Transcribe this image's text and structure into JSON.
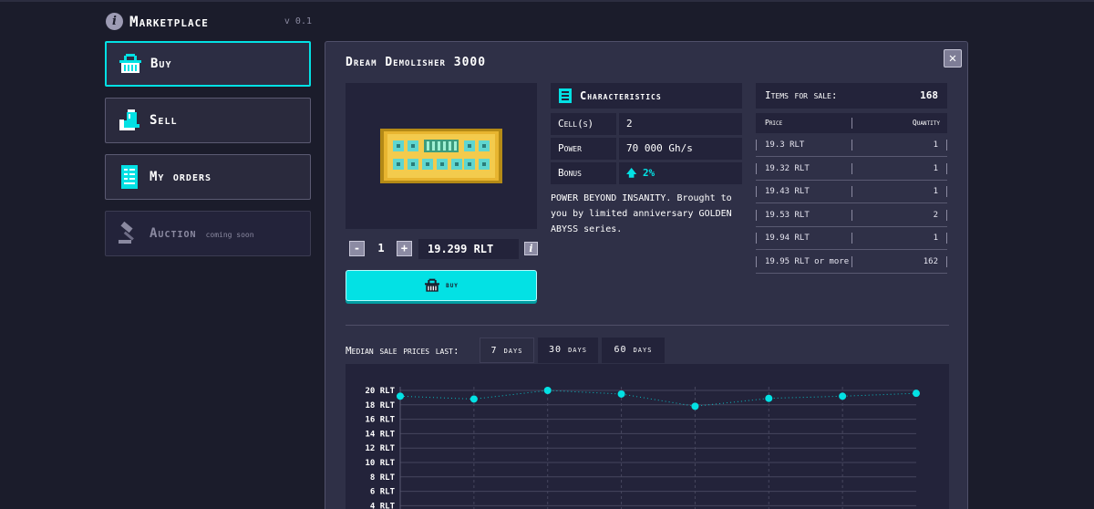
{
  "header": {
    "title": "Marketplace",
    "version": "v 0.1"
  },
  "sidebar": {
    "items": [
      {
        "label": "Buy",
        "icon": "basket-icon"
      },
      {
        "label": "Sell",
        "icon": "hand-bag-icon"
      },
      {
        "label": "My orders",
        "icon": "receipt-icon"
      },
      {
        "label": "Auction",
        "icon": "gavel-icon",
        "note": "coming soon"
      }
    ]
  },
  "product": {
    "title": "Dream Demolisher 3000",
    "quantity": "1",
    "price": "19.299 RLT",
    "buy_label": "buy"
  },
  "characteristics": {
    "title": "Characteristics",
    "rows": [
      {
        "key": "Cell(s)",
        "value": "2"
      },
      {
        "key": "Power",
        "value": "70 000 Gh/s"
      },
      {
        "key": "Bonus",
        "value": "2%"
      }
    ],
    "description": "POWER BEYOND INSANITY. Brought to you by limited anniversary GOLDEN ABYSS series."
  },
  "sale": {
    "label": "Items for sale:",
    "count": "168",
    "col_price": "Price",
    "col_quantity": "Quantity",
    "rows": [
      {
        "price": "19.3 RLT",
        "quantity": "1"
      },
      {
        "price": "19.32 RLT",
        "quantity": "1"
      },
      {
        "price": "19.43 RLT",
        "quantity": "1"
      },
      {
        "price": "19.53 RLT",
        "quantity": "2"
      },
      {
        "price": "19.94 RLT",
        "quantity": "1"
      },
      {
        "price": "19.95 RLT or more",
        "quantity": "162"
      }
    ]
  },
  "median": {
    "label": "Median sale prices last:",
    "tabs": [
      "7 days",
      "30 days",
      "60 days"
    ],
    "active_tab": "7 days"
  },
  "colors": {
    "accent": "#03e1e4",
    "background": "#1b1c2b",
    "panel": "#2f3047",
    "cell": "#23233a"
  },
  "chart_data": {
    "type": "line",
    "x": [
      1,
      2,
      3,
      4,
      5,
      6,
      7,
      8
    ],
    "values": [
      19.2,
      18.8,
      20.0,
      19.5,
      17.8,
      18.9,
      19.2,
      19.6
    ],
    "yticks": [
      "20 RLT",
      "18 RLT",
      "16 RLT",
      "14 RLT",
      "12 RLT",
      "10 RLT",
      "8 RLT",
      "6 RLT",
      "4 RLT"
    ],
    "ylim_visible": [
      4,
      20
    ],
    "grid": true
  }
}
